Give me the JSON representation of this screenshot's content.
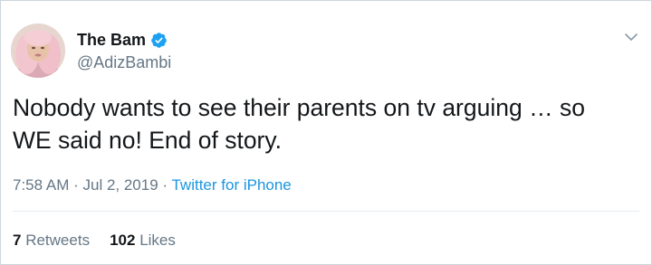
{
  "user": {
    "display_name": "The Bam",
    "handle": "@AdizBambi",
    "verified": true,
    "avatar_icon": "profile-photo"
  },
  "tweet": {
    "text": "Nobody wants to see their parents on tv arguing … so WE said no! End of story.",
    "time": "7:58 AM",
    "separator_1": " · ",
    "date": "Jul 2, 2019",
    "separator_2": " · ",
    "source": "Twitter for iPhone"
  },
  "stats": {
    "retweets_count": "7",
    "retweets_label": "Retweets",
    "likes_count": "102",
    "likes_label": "Likes"
  },
  "colors": {
    "link": "#1b95e0",
    "verified_badge": "#1da1f2",
    "muted_text": "#657786",
    "primary_text": "#14171a"
  },
  "icons": {
    "verified": "verified-badge-icon",
    "menu": "chevron-down-icon"
  }
}
